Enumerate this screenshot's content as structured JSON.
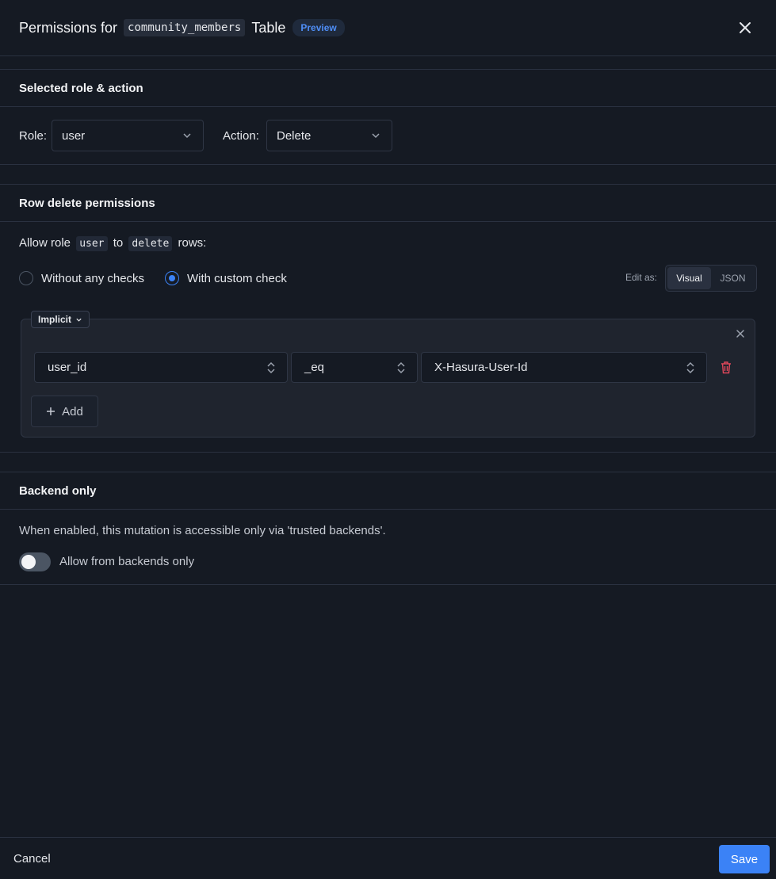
{
  "header": {
    "title_prefix": "Permissions for",
    "table_name": "community_members",
    "title_suffix": "Table",
    "badge": "Preview",
    "close_icon": "close-icon"
  },
  "role_section": {
    "title": "Selected role & action",
    "role_label": "Role:",
    "role_value": "user",
    "action_label": "Action:",
    "action_value": "Delete"
  },
  "row_section": {
    "title": "Row delete permissions",
    "allow_prefix": "Allow role",
    "role": "user",
    "allow_to": "to",
    "action": "delete",
    "allow_suffix": "rows:",
    "radio_without": "Without any checks",
    "radio_with": "With custom check",
    "selected_radio": "With custom check",
    "edit_as_label": "Edit as:",
    "edit_tabs": [
      "Visual",
      "JSON"
    ],
    "active_edit_tab": "Visual",
    "implicit_label": "Implicit",
    "rule": {
      "column": "user_id",
      "operator": "_eq",
      "value": "X-Hasura-User-Id"
    },
    "add_label": "Add"
  },
  "backend_section": {
    "title": "Backend only",
    "description": "When enabled, this mutation is accessible only via 'trusted backends'.",
    "toggle_label": "Allow from backends only",
    "toggle_on": false
  },
  "footer": {
    "cancel_label": "Cancel",
    "save_label": "Save"
  },
  "colors": {
    "background": "#151a23",
    "accent": "#3b82f6",
    "danger": "#e0475b"
  }
}
